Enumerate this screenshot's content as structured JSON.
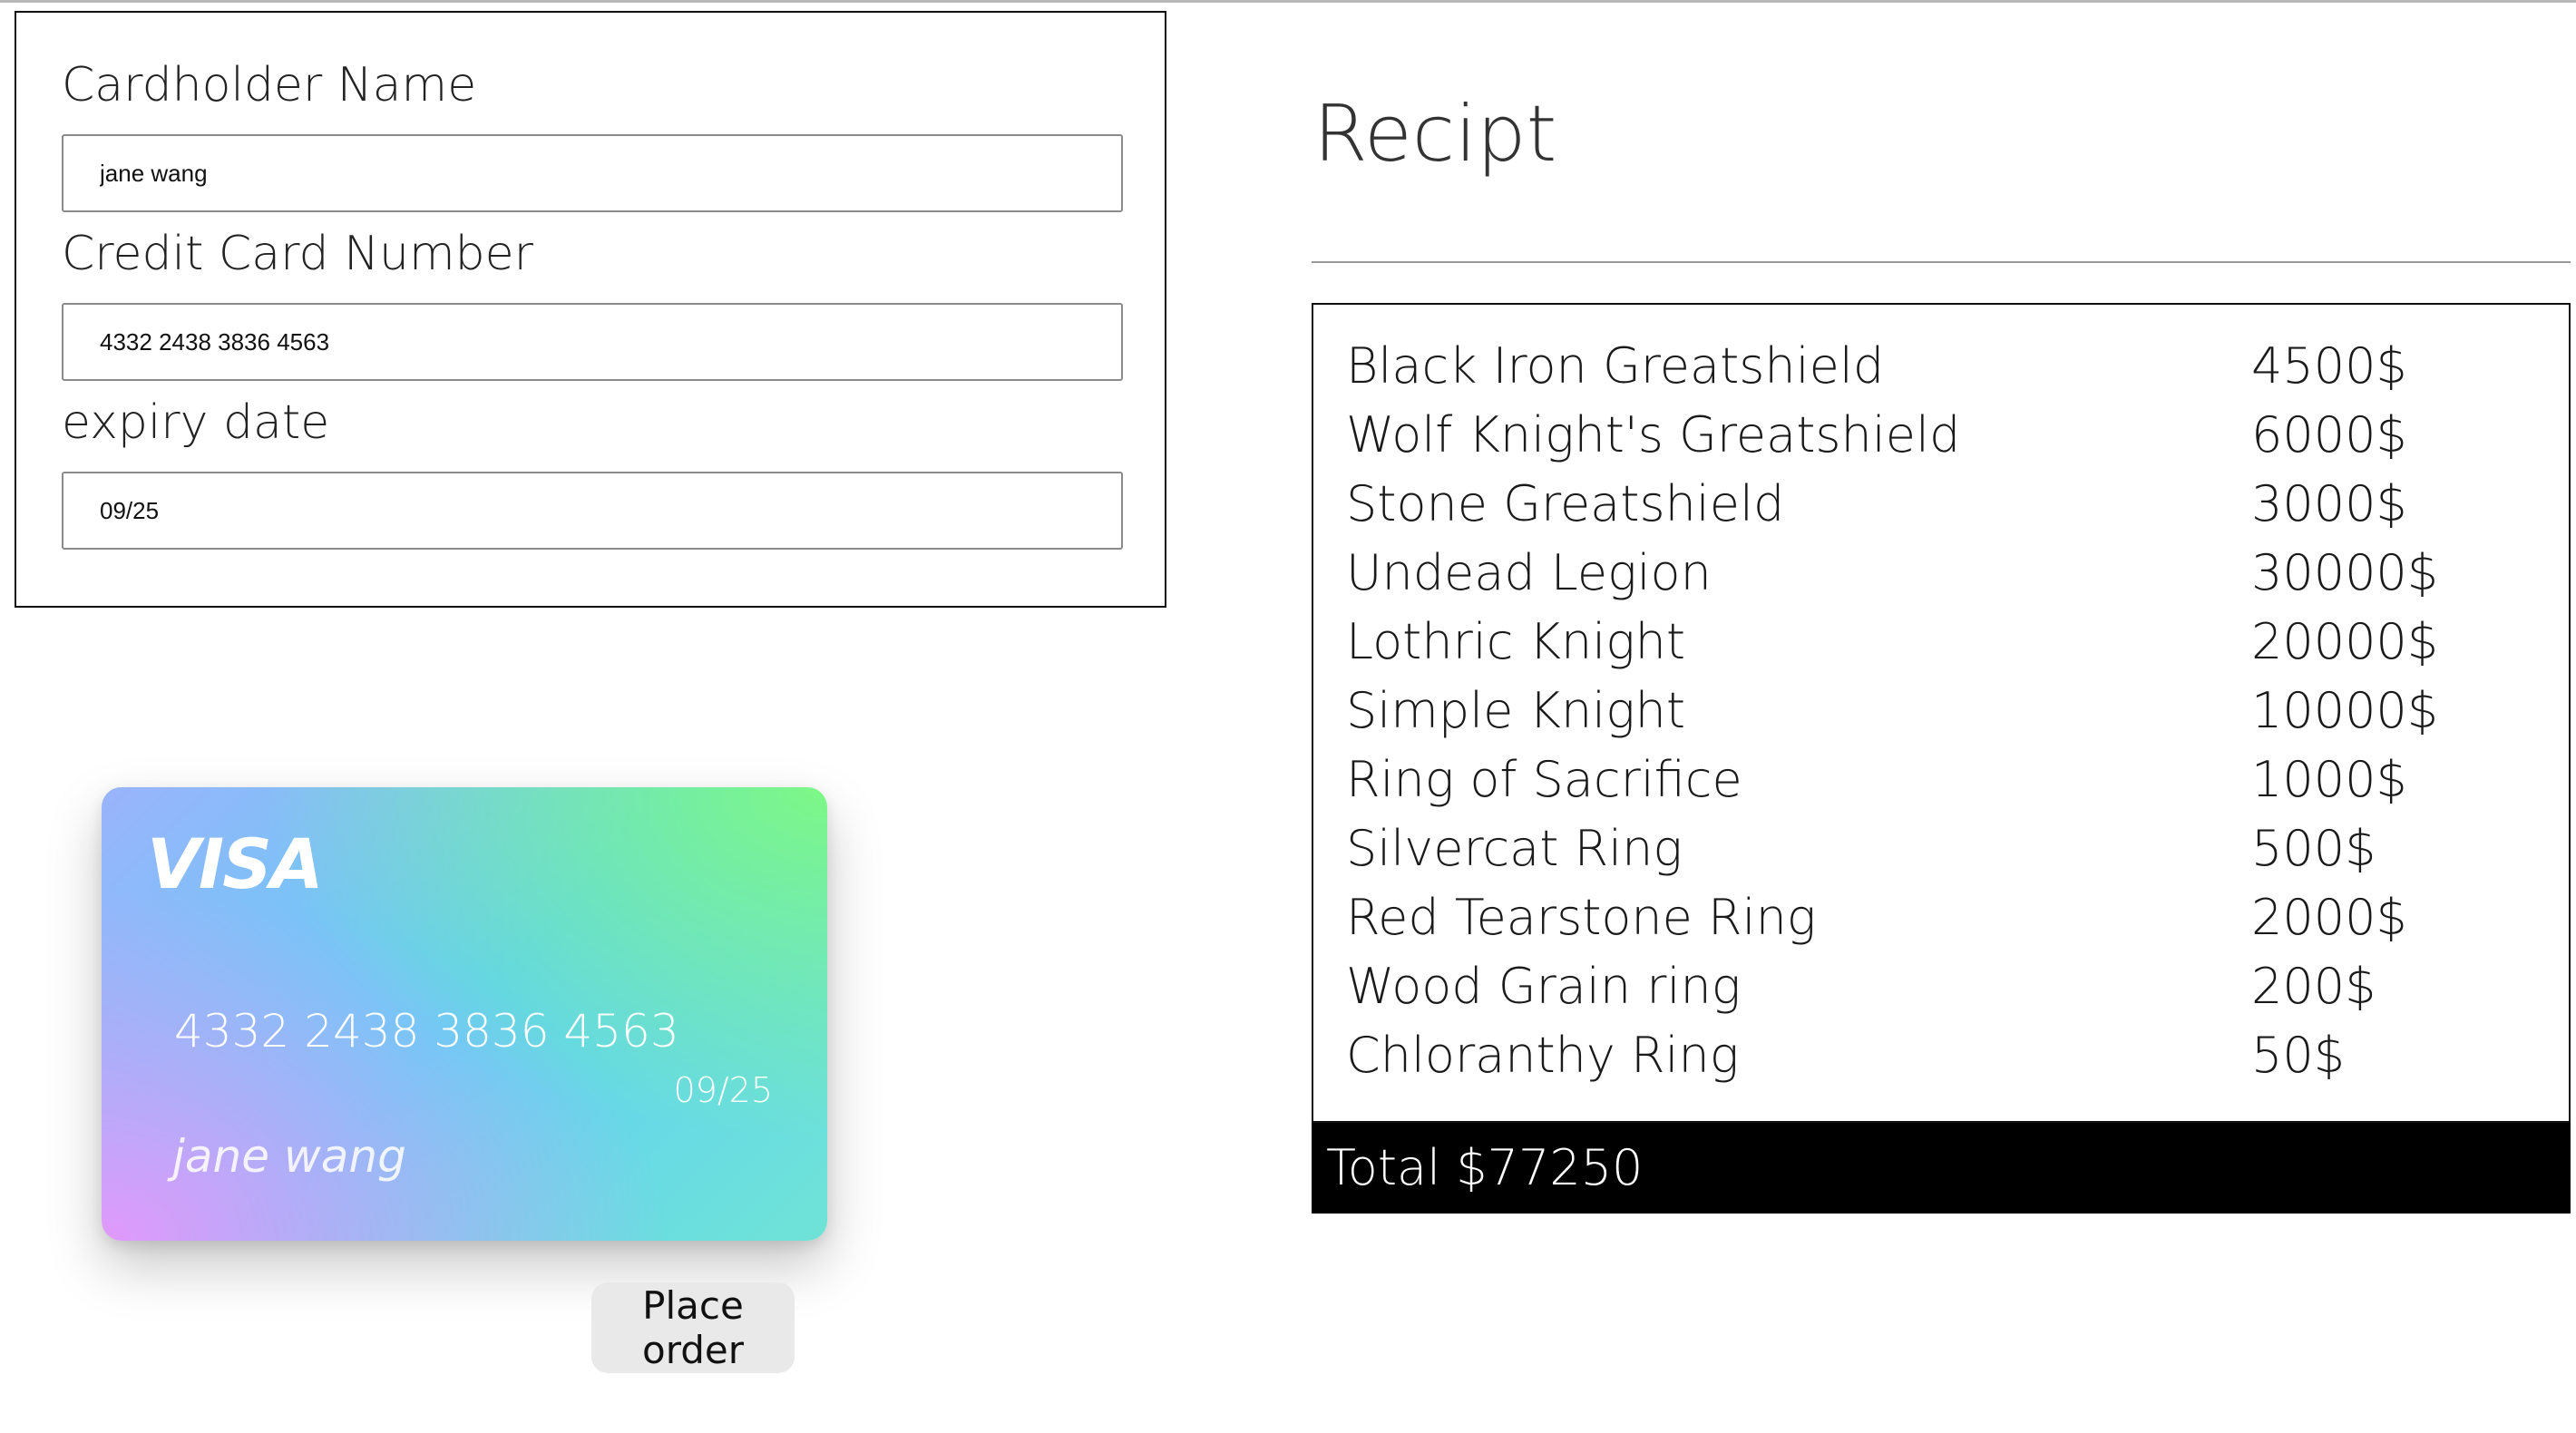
{
  "form": {
    "cardholder": {
      "label": "Cardholder Name",
      "value": "jane wang"
    },
    "card_number": {
      "label": "Credit Card Number",
      "value": "4332 2438 3836 4563"
    },
    "expiry": {
      "label": "expiry date",
      "value": "09/25"
    }
  },
  "card": {
    "brand": "VISA",
    "number": "4332 2438 3836 4563",
    "expiry": "09/25",
    "name": "jane wang"
  },
  "place_order_label": "Place order",
  "receipt": {
    "title": "Recipt",
    "items": [
      {
        "name": "Black Iron Greatshield",
        "price": "4500$"
      },
      {
        "name": "Wolf Knight's Greatshield",
        "price": "6000$"
      },
      {
        "name": "Stone Greatshield",
        "price": "3000$"
      },
      {
        "name": "Undead Legion",
        "price": "30000$"
      },
      {
        "name": "Lothric Knight",
        "price": "20000$"
      },
      {
        "name": "Simple Knight",
        "price": "10000$"
      },
      {
        "name": "Ring of Sacrifice",
        "price": "1000$"
      },
      {
        "name": "Silvercat Ring",
        "price": "500$"
      },
      {
        "name": "Red Tearstone Ring",
        "price": "2000$"
      },
      {
        "name": "Wood Grain ring",
        "price": "200$"
      },
      {
        "name": "Chloranthy Ring",
        "price": "50$"
      }
    ],
    "total": "Total $77250"
  }
}
